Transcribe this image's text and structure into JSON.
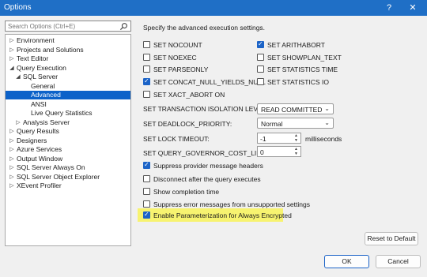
{
  "window": {
    "title": "Options",
    "help_glyph": "?",
    "close_glyph": "✕"
  },
  "search": {
    "placeholder": "Search Options (Ctrl+E)"
  },
  "tree": [
    {
      "label": "Environment",
      "caret": "▷",
      "level": 0
    },
    {
      "label": "Projects and Solutions",
      "caret": "▷",
      "level": 0
    },
    {
      "label": "Text Editor",
      "caret": "▷",
      "level": 0
    },
    {
      "label": "Query Execution",
      "caret": "◢",
      "level": 0
    },
    {
      "label": "SQL Server",
      "caret": "◢",
      "level": 1
    },
    {
      "label": "General",
      "caret": "",
      "level": 2
    },
    {
      "label": "Advanced",
      "caret": "",
      "level": 2,
      "selected": true
    },
    {
      "label": "ANSI",
      "caret": "",
      "level": 2
    },
    {
      "label": "Live Query Statistics",
      "caret": "",
      "level": 2
    },
    {
      "label": "Analysis Server",
      "caret": "▷",
      "level": 1
    },
    {
      "label": "Query Results",
      "caret": "▷",
      "level": 0
    },
    {
      "label": "Designers",
      "caret": "▷",
      "level": 0
    },
    {
      "label": "Azure Services",
      "caret": "▷",
      "level": 0
    },
    {
      "label": "Output Window",
      "caret": "▷",
      "level": 0
    },
    {
      "label": "SQL Server Always On",
      "caret": "▷",
      "level": 0
    },
    {
      "label": "SQL Server Object Explorer",
      "caret": "▷",
      "level": 0
    },
    {
      "label": "XEvent Profiler",
      "caret": "▷",
      "level": 0
    }
  ],
  "main": {
    "description": "Specify the advanced execution settings.",
    "set_options": [
      {
        "label": "SET NOCOUNT",
        "checked": false
      },
      {
        "label": "SET ARITHABORT",
        "checked": true
      },
      {
        "label": "SET NOEXEC",
        "checked": false
      },
      {
        "label": "SET SHOWPLAN_TEXT",
        "checked": false
      },
      {
        "label": "SET PARSEONLY",
        "checked": false
      },
      {
        "label": "SET STATISTICS TIME",
        "checked": false
      },
      {
        "label": "SET CONCAT_NULL_YIELDS_NULL",
        "checked": true
      },
      {
        "label": "SET STATISTICS IO",
        "checked": false
      },
      {
        "label": "SET XACT_ABORT ON",
        "checked": false
      }
    ],
    "isolation": {
      "label": "SET TRANSACTION ISOLATION LEVEL:",
      "value": "READ COMMITTED"
    },
    "deadlock": {
      "label": "SET DEADLOCK_PRIORITY:",
      "value": "Normal"
    },
    "lock_timeout": {
      "label": "SET LOCK TIMEOUT:",
      "value": "-1",
      "unit": "milliseconds"
    },
    "cost_limit": {
      "label": "SET QUERY_GOVERNOR_COST_LIMIT:",
      "value": "0"
    },
    "misc_options": [
      {
        "label": "Suppress provider message headers",
        "checked": true
      },
      {
        "label": "Disconnect after the query executes",
        "checked": false
      },
      {
        "label": "Show completion time",
        "checked": false
      },
      {
        "label": "Suppress error messages from unsupported settings",
        "checked": false
      },
      {
        "label": "Enable Parameterization for Always Encrypted",
        "checked": true
      }
    ]
  },
  "buttons": {
    "reset": "Reset to Default",
    "ok": "OK",
    "cancel": "Cancel"
  },
  "colors": {
    "titlebar": "#1f6fc6",
    "selection": "#0c62c9",
    "checkbox": "#1b63c7",
    "highlight": "#f7f370"
  }
}
